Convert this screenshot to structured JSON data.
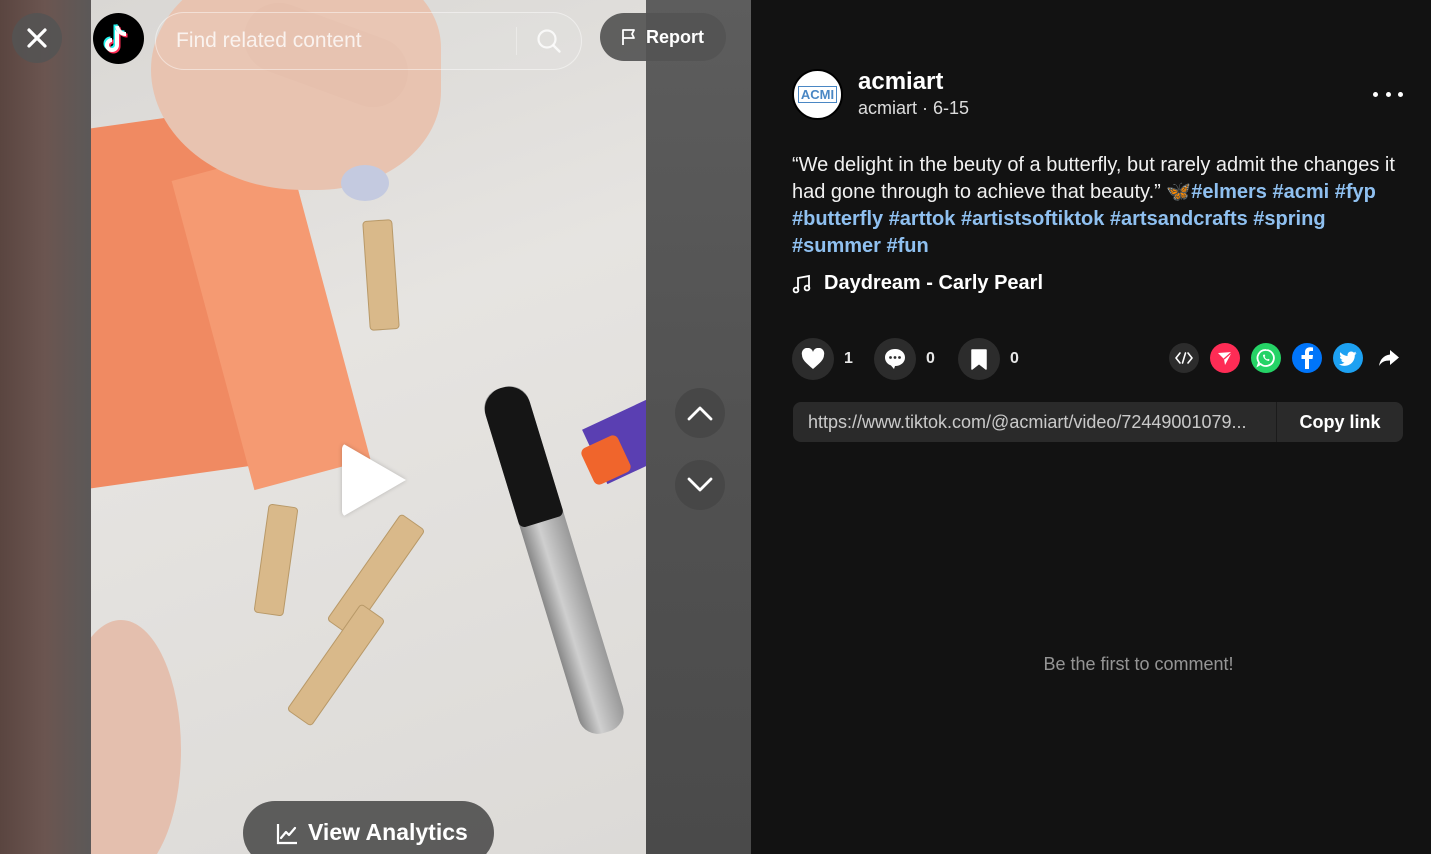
{
  "header": {
    "search_placeholder": "Find related content",
    "report_label": "Report"
  },
  "video": {
    "analytics_label": "View Analytics"
  },
  "author": {
    "display_name": "acmiart",
    "handle": "acmiart",
    "separator": " · ",
    "date": "6-15",
    "avatar_text": "ACMI"
  },
  "caption": {
    "text": "“We delight in the beuty of a butterfly, but rarely admit the changes it had gone through to achieve that beauty.” ",
    "emoji": "🦋",
    "hashtags": [
      "#elmers",
      "#acmi",
      "#fyp",
      "#butterfly",
      "#arttok",
      "#artistsoftiktok",
      "#artsandcrafts",
      "#spring",
      "#summer",
      "#fun"
    ]
  },
  "music": {
    "title": "Daydream - Carly Pearl"
  },
  "actions": {
    "likes": "1",
    "comments": "0",
    "favorites": "0"
  },
  "share": {
    "icons": [
      "embed-icon",
      "send-to-friends-icon",
      "whatsapp-icon",
      "facebook-icon",
      "twitter-icon",
      "share-arrow-icon"
    ]
  },
  "link": {
    "url": "https://www.tiktok.com/@acmiart/video/7244900107966762283",
    "url_display": "https://www.tiktok.com/@acmiart/video/72449001079...",
    "copy_label": "Copy link"
  },
  "comments": {
    "empty_text": "Be the first to comment!"
  },
  "colors": {
    "background": "#121212",
    "hashtag": "#8fc0f0",
    "like_red": "#fe2c55",
    "whatsapp": "#25d366",
    "facebook": "#0075fa",
    "twitter": "#1da1f2"
  }
}
